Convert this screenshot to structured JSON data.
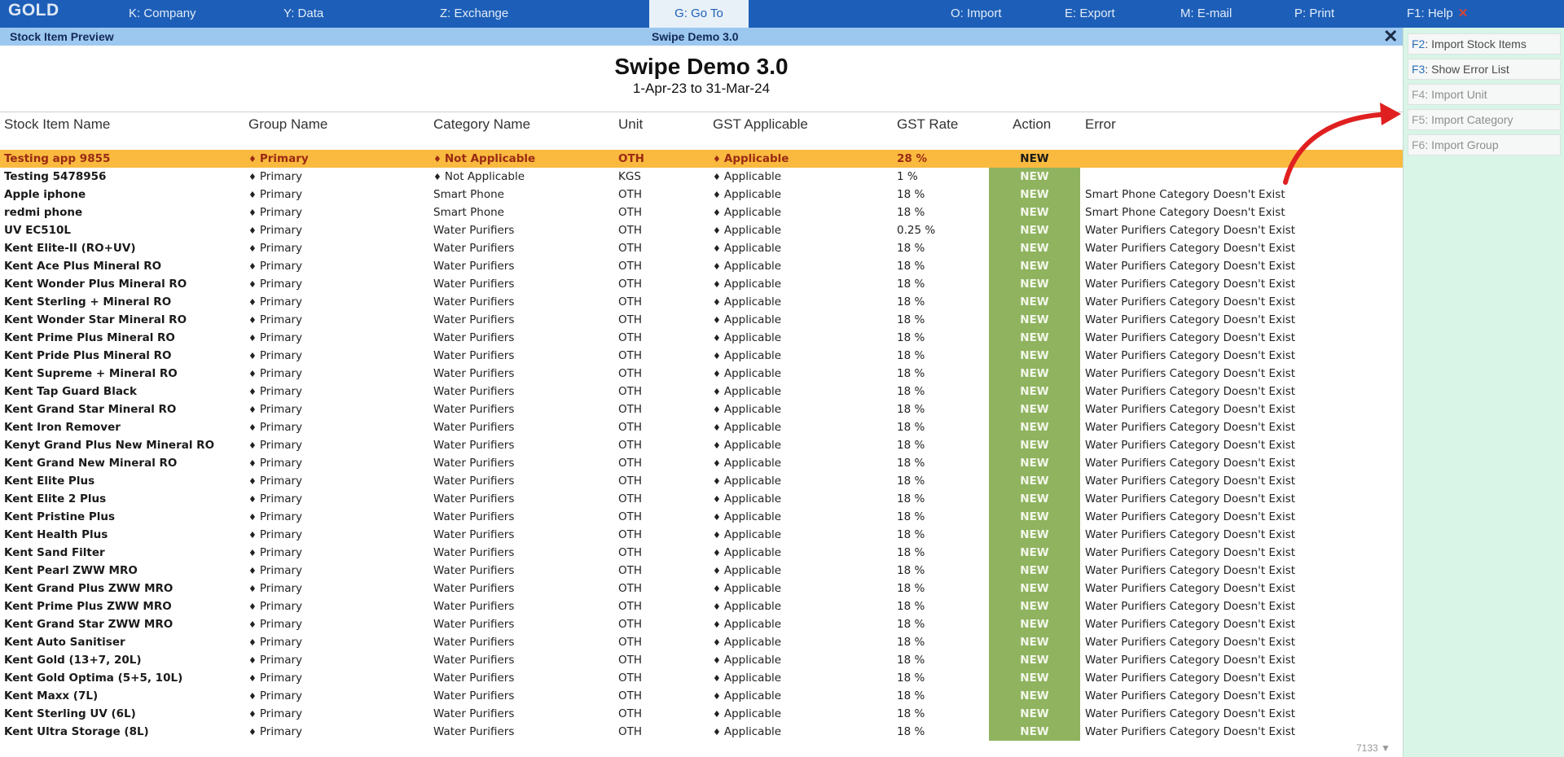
{
  "logo": "GOLD",
  "menu": [
    {
      "key": "K",
      "label": ": Company"
    },
    {
      "key": "Y",
      "label": ": Data"
    },
    {
      "key": "Z",
      "label": ": Exchange"
    },
    {
      "key": "G",
      "label": ": Go To"
    },
    {
      "key": "O",
      "label": ": Import"
    },
    {
      "key": "E",
      "label": ": Export"
    },
    {
      "key": "M",
      "label": ": E-mail"
    },
    {
      "key": "P",
      "label": ": Print"
    },
    {
      "key": "F1",
      "label": ": Help"
    }
  ],
  "subbar": {
    "title": "Stock Item Preview",
    "company": "Swipe Demo 3.0",
    "close": "✕"
  },
  "report": {
    "company": "Swipe Demo 3.0",
    "period": "1-Apr-23 to 31-Mar-24"
  },
  "columns": [
    "Stock Item Name",
    "Group Name",
    "Category Name",
    "Unit",
    "GST Applicable",
    "GST Rate",
    "Action",
    "Error"
  ],
  "side_buttons": [
    {
      "key": "F2",
      "label": ": Import Stock Items",
      "enabled": true
    },
    {
      "key": "F3",
      "label": ": Show Error List",
      "enabled": true
    },
    {
      "key": "F4",
      "label": ": Import Unit",
      "enabled": false
    },
    {
      "key": "F5",
      "label": ": Import Category",
      "enabled": false
    },
    {
      "key": "F6",
      "label": ": Import Group",
      "enabled": false
    }
  ],
  "rows": [
    {
      "name": "Testing app 9855",
      "group": "Primary",
      "category": "Not Applicable",
      "cat_diamond": true,
      "unit": "OTH",
      "gst": "Applicable",
      "rate": "28 %",
      "action": "NEW",
      "error": "",
      "selected": true
    },
    {
      "name": "Testing 5478956",
      "group": "Primary",
      "category": "Not Applicable",
      "cat_diamond": true,
      "unit": "KGS",
      "gst": "Applicable",
      "rate": "1 %",
      "action": "NEW",
      "error": ""
    },
    {
      "name": "Apple iphone",
      "group": "Primary",
      "category": "Smart Phone",
      "unit": "OTH",
      "gst": "Applicable",
      "rate": "18 %",
      "action": "NEW",
      "error": "Smart Phone Category Doesn't Exist"
    },
    {
      "name": "redmi phone",
      "group": "Primary",
      "category": "Smart Phone",
      "unit": "OTH",
      "gst": "Applicable",
      "rate": "18 %",
      "action": "NEW",
      "error": "Smart Phone Category Doesn't Exist"
    },
    {
      "name": "UV EC510L",
      "group": "Primary",
      "category": "Water Purifiers",
      "unit": "OTH",
      "gst": "Applicable",
      "rate": "0.25 %",
      "action": "NEW",
      "error": "Water Purifiers Category Doesn't Exist"
    },
    {
      "name": "Kent Elite-II (RO+UV)",
      "group": "Primary",
      "category": "Water Purifiers",
      "unit": "OTH",
      "gst": "Applicable",
      "rate": "18 %",
      "action": "NEW",
      "error": "Water Purifiers Category Doesn't Exist"
    },
    {
      "name": "Kent Ace Plus Mineral RO",
      "group": "Primary",
      "category": "Water Purifiers",
      "unit": "OTH",
      "gst": "Applicable",
      "rate": "18 %",
      "action": "NEW",
      "error": "Water Purifiers Category Doesn't Exist"
    },
    {
      "name": "Kent Wonder Plus Mineral RO",
      "group": "Primary",
      "category": "Water Purifiers",
      "unit": "OTH",
      "gst": "Applicable",
      "rate": "18 %",
      "action": "NEW",
      "error": "Water Purifiers Category Doesn't Exist"
    },
    {
      "name": "Kent Sterling + Mineral RO",
      "group": "Primary",
      "category": "Water Purifiers",
      "unit": "OTH",
      "gst": "Applicable",
      "rate": "18 %",
      "action": "NEW",
      "error": "Water Purifiers Category Doesn't Exist"
    },
    {
      "name": "Kent Wonder Star Mineral RO",
      "group": "Primary",
      "category": "Water Purifiers",
      "unit": "OTH",
      "gst": "Applicable",
      "rate": "18 %",
      "action": "NEW",
      "error": "Water Purifiers Category Doesn't Exist"
    },
    {
      "name": "Kent Prime Plus Mineral RO",
      "group": "Primary",
      "category": "Water Purifiers",
      "unit": "OTH",
      "gst": "Applicable",
      "rate": "18 %",
      "action": "NEW",
      "error": "Water Purifiers Category Doesn't Exist"
    },
    {
      "name": "Kent Pride Plus Mineral RO",
      "group": "Primary",
      "category": "Water Purifiers",
      "unit": "OTH",
      "gst": "Applicable",
      "rate": "18 %",
      "action": "NEW",
      "error": "Water Purifiers Category Doesn't Exist"
    },
    {
      "name": "Kent Supreme + Mineral RO",
      "group": "Primary",
      "category": "Water Purifiers",
      "unit": "OTH",
      "gst": "Applicable",
      "rate": "18 %",
      "action": "NEW",
      "error": "Water Purifiers Category Doesn't Exist"
    },
    {
      "name": "Kent Tap Guard Black",
      "group": "Primary",
      "category": "Water Purifiers",
      "unit": "OTH",
      "gst": "Applicable",
      "rate": "18 %",
      "action": "NEW",
      "error": "Water Purifiers Category Doesn't Exist"
    },
    {
      "name": "Kent Grand Star Mineral RO",
      "group": "Primary",
      "category": "Water Purifiers",
      "unit": "OTH",
      "gst": "Applicable",
      "rate": "18 %",
      "action": "NEW",
      "error": "Water Purifiers Category Doesn't Exist"
    },
    {
      "name": "Kent Iron Remover",
      "group": "Primary",
      "category": "Water Purifiers",
      "unit": "OTH",
      "gst": "Applicable",
      "rate": "18 %",
      "action": "NEW",
      "error": "Water Purifiers Category Doesn't Exist"
    },
    {
      "name": "Kenyt Grand Plus New Mineral RO",
      "group": "Primary",
      "category": "Water Purifiers",
      "unit": "OTH",
      "gst": "Applicable",
      "rate": "18 %",
      "action": "NEW",
      "error": "Water Purifiers Category Doesn't Exist"
    },
    {
      "name": "Kent Grand New Mineral RO",
      "group": "Primary",
      "category": "Water Purifiers",
      "unit": "OTH",
      "gst": "Applicable",
      "rate": "18 %",
      "action": "NEW",
      "error": "Water Purifiers Category Doesn't Exist"
    },
    {
      "name": "Kent Elite Plus",
      "group": "Primary",
      "category": "Water Purifiers",
      "unit": "OTH",
      "gst": "Applicable",
      "rate": "18 %",
      "action": "NEW",
      "error": "Water Purifiers Category Doesn't Exist"
    },
    {
      "name": "Kent Elite 2 Plus",
      "group": "Primary",
      "category": "Water Purifiers",
      "unit": "OTH",
      "gst": "Applicable",
      "rate": "18 %",
      "action": "NEW",
      "error": "Water Purifiers Category Doesn't Exist"
    },
    {
      "name": "Kent Pristine Plus",
      "group": "Primary",
      "category": "Water Purifiers",
      "unit": "OTH",
      "gst": "Applicable",
      "rate": "18 %",
      "action": "NEW",
      "error": "Water Purifiers Category Doesn't Exist"
    },
    {
      "name": "Kent Health Plus",
      "group": "Primary",
      "category": "Water Purifiers",
      "unit": "OTH",
      "gst": "Applicable",
      "rate": "18 %",
      "action": "NEW",
      "error": "Water Purifiers Category Doesn't Exist"
    },
    {
      "name": "Kent Sand Filter",
      "group": "Primary",
      "category": "Water Purifiers",
      "unit": "OTH",
      "gst": "Applicable",
      "rate": "18 %",
      "action": "NEW",
      "error": "Water Purifiers Category Doesn't Exist"
    },
    {
      "name": "Kent Pearl ZWW MRO",
      "group": "Primary",
      "category": "Water Purifiers",
      "unit": "OTH",
      "gst": "Applicable",
      "rate": "18 %",
      "action": "NEW",
      "error": "Water Purifiers Category Doesn't Exist"
    },
    {
      "name": "Kent Grand Plus ZWW MRO",
      "group": "Primary",
      "category": "Water Purifiers",
      "unit": "OTH",
      "gst": "Applicable",
      "rate": "18 %",
      "action": "NEW",
      "error": "Water Purifiers Category Doesn't Exist"
    },
    {
      "name": "Kent Prime Plus ZWW MRO",
      "group": "Primary",
      "category": "Water Purifiers",
      "unit": "OTH",
      "gst": "Applicable",
      "rate": "18 %",
      "action": "NEW",
      "error": "Water Purifiers Category Doesn't Exist"
    },
    {
      "name": "Kent Grand Star ZWW MRO",
      "group": "Primary",
      "category": "Water Purifiers",
      "unit": "OTH",
      "gst": "Applicable",
      "rate": "18 %",
      "action": "NEW",
      "error": "Water Purifiers Category Doesn't Exist"
    },
    {
      "name": "Kent Auto Sanitiser",
      "group": "Primary",
      "category": "Water Purifiers",
      "unit": "OTH",
      "gst": "Applicable",
      "rate": "18 %",
      "action": "NEW",
      "error": "Water Purifiers Category Doesn't Exist"
    },
    {
      "name": "Kent Gold (13+7, 20L)",
      "group": "Primary",
      "category": "Water Purifiers",
      "unit": "OTH",
      "gst": "Applicable",
      "rate": "18 %",
      "action": "NEW",
      "error": "Water Purifiers Category Doesn't Exist"
    },
    {
      "name": "Kent Gold Optima (5+5, 10L)",
      "group": "Primary",
      "category": "Water Purifiers",
      "unit": "OTH",
      "gst": "Applicable",
      "rate": "18 %",
      "action": "NEW",
      "error": "Water Purifiers Category Doesn't Exist"
    },
    {
      "name": "Kent Maxx (7L)",
      "group": "Primary",
      "category": "Water Purifiers",
      "unit": "OTH",
      "gst": "Applicable",
      "rate": "18 %",
      "action": "NEW",
      "error": "Water Purifiers Category Doesn't Exist"
    },
    {
      "name": "Kent Sterling UV (6L)",
      "group": "Primary",
      "category": "Water Purifiers",
      "unit": "OTH",
      "gst": "Applicable",
      "rate": "18 %",
      "action": "NEW",
      "error": "Water Purifiers Category Doesn't Exist"
    },
    {
      "name": "Kent Ultra Storage (8L)",
      "group": "Primary",
      "category": "Water Purifiers",
      "unit": "OTH",
      "gst": "Applicable",
      "rate": "18 %",
      "action": "NEW",
      "error": "Water Purifiers Category Doesn't Exist"
    }
  ],
  "page_indicator": "7133 ▼",
  "colors": {
    "topbar": "#1d5fb8",
    "subbar": "#9cc8ef",
    "selected_row": "#f9ba3f",
    "action_cell": "#8fb35f",
    "side_panel": "#d8f5e7",
    "annotation_arrow": "#e02020"
  }
}
